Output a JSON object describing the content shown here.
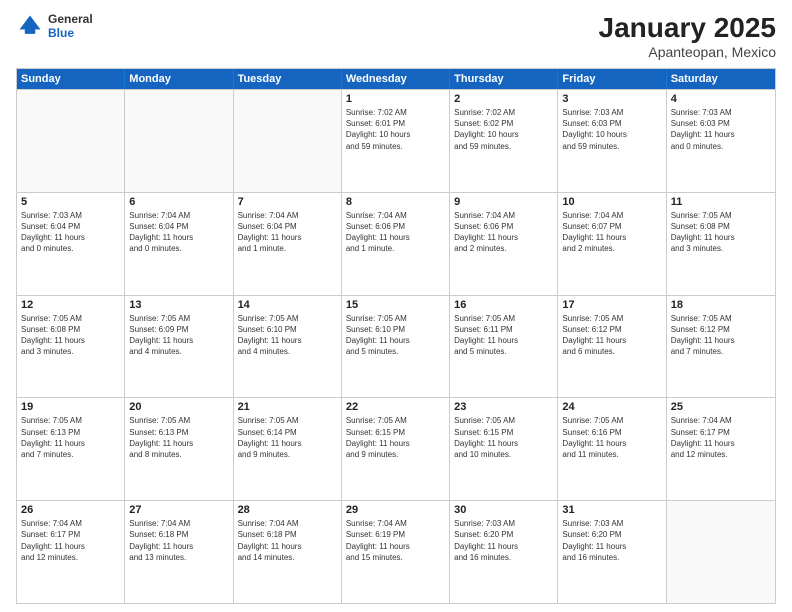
{
  "logo": {
    "general": "General",
    "blue": "Blue"
  },
  "title": "January 2025",
  "subtitle": "Apanteopan, Mexico",
  "days": [
    "Sunday",
    "Monday",
    "Tuesday",
    "Wednesday",
    "Thursday",
    "Friday",
    "Saturday"
  ],
  "weeks": [
    [
      {
        "day": "",
        "info": ""
      },
      {
        "day": "",
        "info": ""
      },
      {
        "day": "",
        "info": ""
      },
      {
        "day": "1",
        "info": "Sunrise: 7:02 AM\nSunset: 6:01 PM\nDaylight: 10 hours\nand 59 minutes."
      },
      {
        "day": "2",
        "info": "Sunrise: 7:02 AM\nSunset: 6:02 PM\nDaylight: 10 hours\nand 59 minutes."
      },
      {
        "day": "3",
        "info": "Sunrise: 7:03 AM\nSunset: 6:03 PM\nDaylight: 10 hours\nand 59 minutes."
      },
      {
        "day": "4",
        "info": "Sunrise: 7:03 AM\nSunset: 6:03 PM\nDaylight: 11 hours\nand 0 minutes."
      }
    ],
    [
      {
        "day": "5",
        "info": "Sunrise: 7:03 AM\nSunset: 6:04 PM\nDaylight: 11 hours\nand 0 minutes."
      },
      {
        "day": "6",
        "info": "Sunrise: 7:04 AM\nSunset: 6:04 PM\nDaylight: 11 hours\nand 0 minutes."
      },
      {
        "day": "7",
        "info": "Sunrise: 7:04 AM\nSunset: 6:04 PM\nDaylight: 11 hours\nand 1 minute."
      },
      {
        "day": "8",
        "info": "Sunrise: 7:04 AM\nSunset: 6:06 PM\nDaylight: 11 hours\nand 1 minute."
      },
      {
        "day": "9",
        "info": "Sunrise: 7:04 AM\nSunset: 6:06 PM\nDaylight: 11 hours\nand 2 minutes."
      },
      {
        "day": "10",
        "info": "Sunrise: 7:04 AM\nSunset: 6:07 PM\nDaylight: 11 hours\nand 2 minutes."
      },
      {
        "day": "11",
        "info": "Sunrise: 7:05 AM\nSunset: 6:08 PM\nDaylight: 11 hours\nand 3 minutes."
      }
    ],
    [
      {
        "day": "12",
        "info": "Sunrise: 7:05 AM\nSunset: 6:08 PM\nDaylight: 11 hours\nand 3 minutes."
      },
      {
        "day": "13",
        "info": "Sunrise: 7:05 AM\nSunset: 6:09 PM\nDaylight: 11 hours\nand 4 minutes."
      },
      {
        "day": "14",
        "info": "Sunrise: 7:05 AM\nSunset: 6:10 PM\nDaylight: 11 hours\nand 4 minutes."
      },
      {
        "day": "15",
        "info": "Sunrise: 7:05 AM\nSunset: 6:10 PM\nDaylight: 11 hours\nand 5 minutes."
      },
      {
        "day": "16",
        "info": "Sunrise: 7:05 AM\nSunset: 6:11 PM\nDaylight: 11 hours\nand 5 minutes."
      },
      {
        "day": "17",
        "info": "Sunrise: 7:05 AM\nSunset: 6:12 PM\nDaylight: 11 hours\nand 6 minutes."
      },
      {
        "day": "18",
        "info": "Sunrise: 7:05 AM\nSunset: 6:12 PM\nDaylight: 11 hours\nand 7 minutes."
      }
    ],
    [
      {
        "day": "19",
        "info": "Sunrise: 7:05 AM\nSunset: 6:13 PM\nDaylight: 11 hours\nand 7 minutes."
      },
      {
        "day": "20",
        "info": "Sunrise: 7:05 AM\nSunset: 6:13 PM\nDaylight: 11 hours\nand 8 minutes."
      },
      {
        "day": "21",
        "info": "Sunrise: 7:05 AM\nSunset: 6:14 PM\nDaylight: 11 hours\nand 9 minutes."
      },
      {
        "day": "22",
        "info": "Sunrise: 7:05 AM\nSunset: 6:15 PM\nDaylight: 11 hours\nand 9 minutes."
      },
      {
        "day": "23",
        "info": "Sunrise: 7:05 AM\nSunset: 6:15 PM\nDaylight: 11 hours\nand 10 minutes."
      },
      {
        "day": "24",
        "info": "Sunrise: 7:05 AM\nSunset: 6:16 PM\nDaylight: 11 hours\nand 11 minutes."
      },
      {
        "day": "25",
        "info": "Sunrise: 7:04 AM\nSunset: 6:17 PM\nDaylight: 11 hours\nand 12 minutes."
      }
    ],
    [
      {
        "day": "26",
        "info": "Sunrise: 7:04 AM\nSunset: 6:17 PM\nDaylight: 11 hours\nand 12 minutes."
      },
      {
        "day": "27",
        "info": "Sunrise: 7:04 AM\nSunset: 6:18 PM\nDaylight: 11 hours\nand 13 minutes."
      },
      {
        "day": "28",
        "info": "Sunrise: 7:04 AM\nSunset: 6:18 PM\nDaylight: 11 hours\nand 14 minutes."
      },
      {
        "day": "29",
        "info": "Sunrise: 7:04 AM\nSunset: 6:19 PM\nDaylight: 11 hours\nand 15 minutes."
      },
      {
        "day": "30",
        "info": "Sunrise: 7:03 AM\nSunset: 6:20 PM\nDaylight: 11 hours\nand 16 minutes."
      },
      {
        "day": "31",
        "info": "Sunrise: 7:03 AM\nSunset: 6:20 PM\nDaylight: 11 hours\nand 16 minutes."
      },
      {
        "day": "",
        "info": ""
      }
    ]
  ]
}
